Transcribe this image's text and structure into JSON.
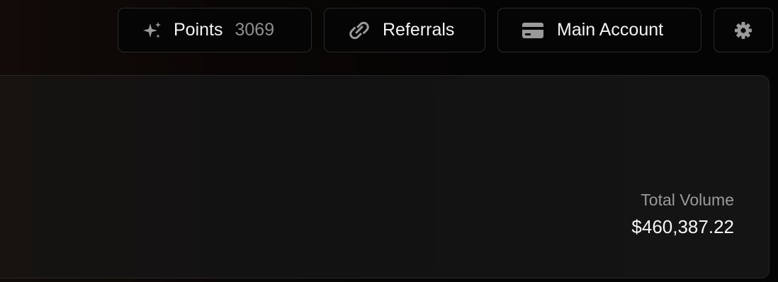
{
  "topbar": {
    "points": {
      "label": "Points",
      "value": "3069",
      "icon": "sparkles-icon"
    },
    "referrals": {
      "label": "Referrals",
      "icon": "link-icon"
    },
    "account": {
      "label": "Main Account",
      "icon": "credit-card-icon"
    },
    "settings": {
      "icon": "gear-icon"
    }
  },
  "panel": {
    "total_volume_label": "Total Volume",
    "total_volume_value": "$460,387.22"
  },
  "colors": {
    "background": "#050404",
    "panel": "#131313",
    "border": "#2a2a2a",
    "text": "#f4f4f4",
    "muted": "#8e8e8e"
  }
}
